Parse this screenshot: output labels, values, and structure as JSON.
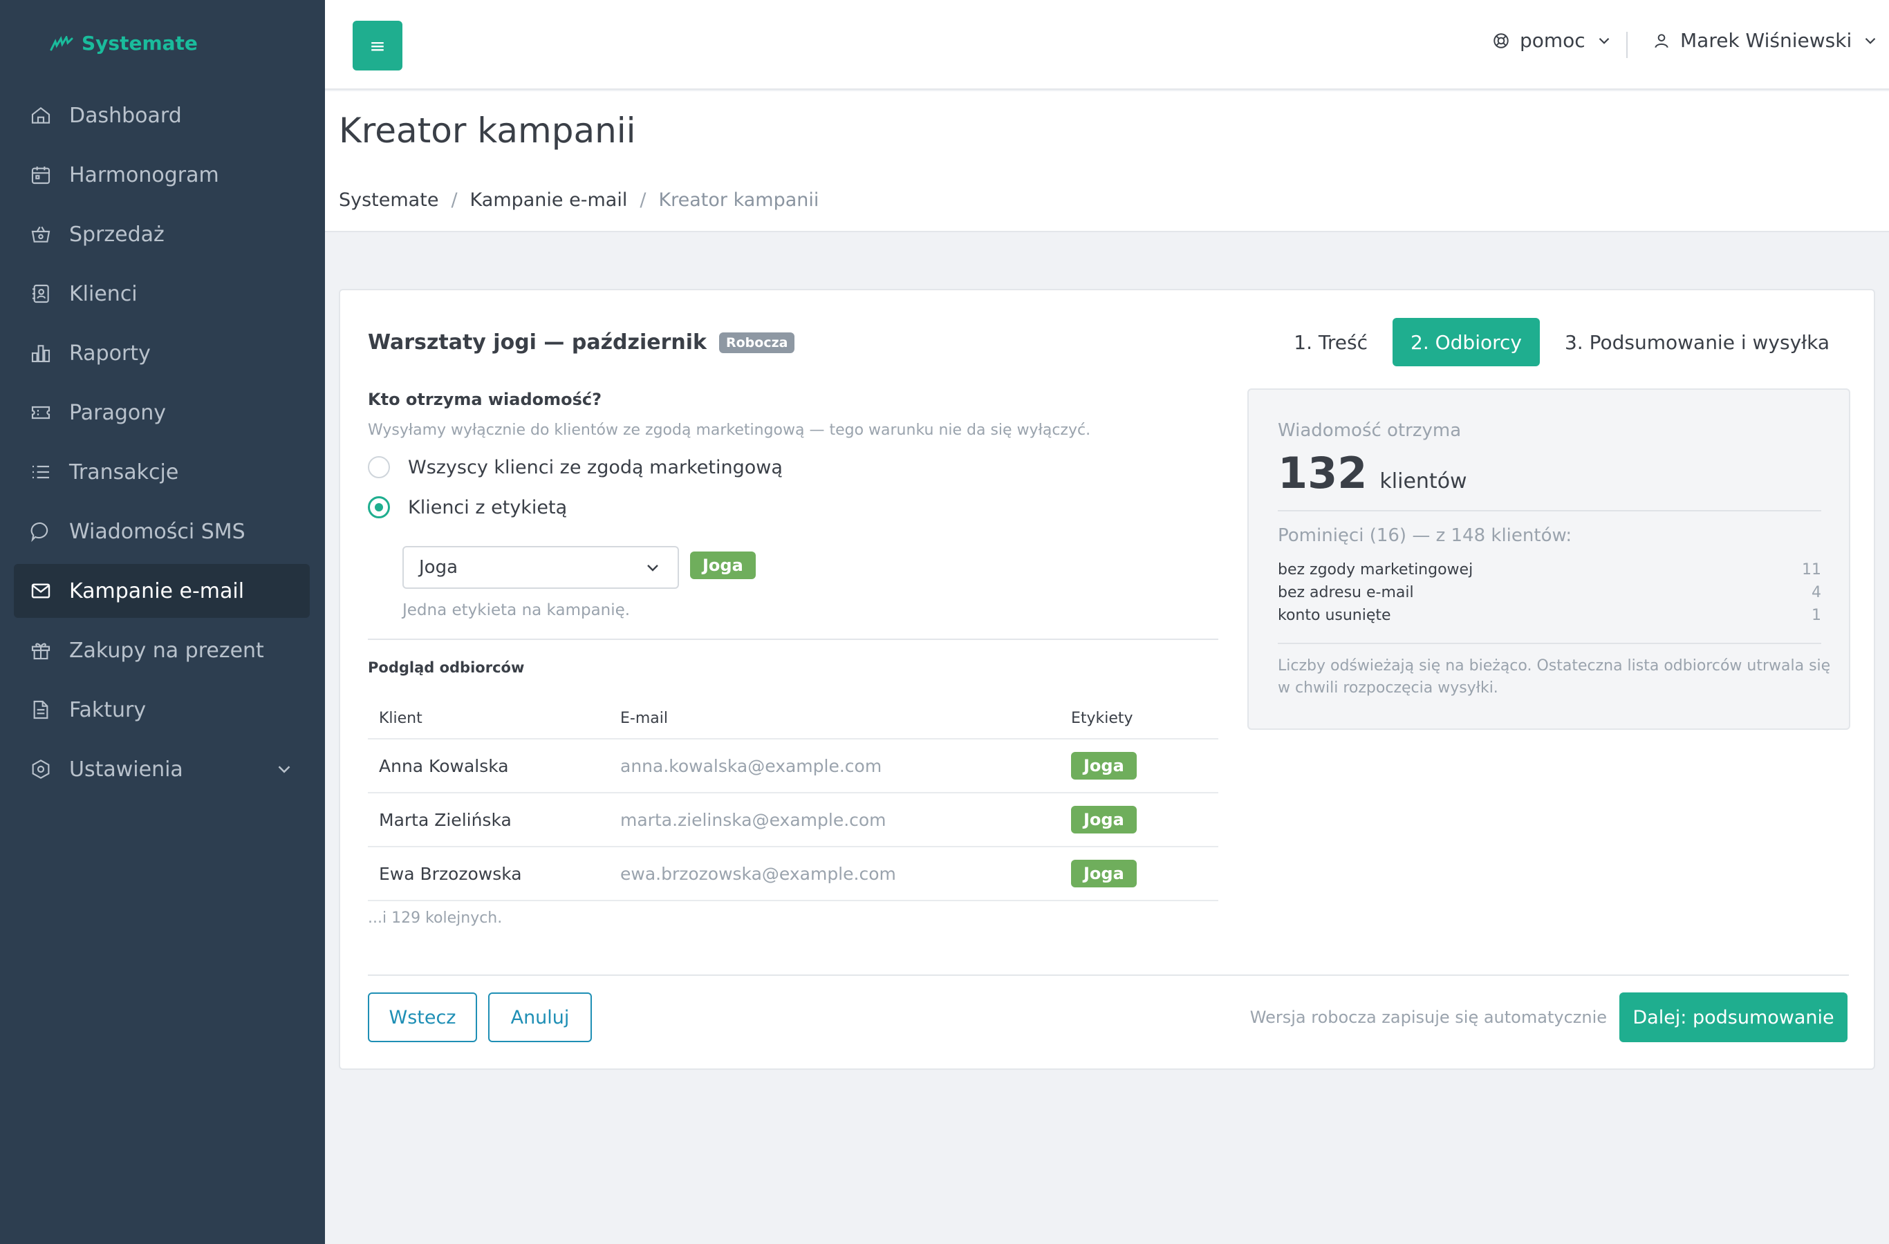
{
  "brand": {
    "name": "Systemate"
  },
  "sidebar": {
    "items": [
      {
        "label": "Dashboard",
        "icon": "home-icon"
      },
      {
        "label": "Harmonogram",
        "icon": "calendar-icon"
      },
      {
        "label": "Sprzedaż",
        "icon": "basket-icon"
      },
      {
        "label": "Klienci",
        "icon": "contacts-icon"
      },
      {
        "label": "Raporty",
        "icon": "bar-chart-icon"
      },
      {
        "label": "Paragony",
        "icon": "ticket-icon"
      },
      {
        "label": "Transakcje",
        "icon": "list-icon"
      },
      {
        "label": "Wiadomości SMS",
        "icon": "message-icon"
      },
      {
        "label": "Kampanie e-mail",
        "icon": "mail-icon",
        "active": true
      },
      {
        "label": "Zakupy na prezent",
        "icon": "gift-icon"
      },
      {
        "label": "Faktury",
        "icon": "document-icon"
      },
      {
        "label": "Ustawienia",
        "icon": "settings-icon",
        "has_submenu": true
      }
    ]
  },
  "topbar": {
    "menu_glyph": "≡",
    "help_label": "pomoc",
    "user_name": "Marek Wiśniewski"
  },
  "page": {
    "title": "Kreator kampanii",
    "breadcrumb": [
      "Systemate",
      "Kampanie e-mail",
      "Kreator kampanii"
    ],
    "breadcrumb_sep": "/"
  },
  "campaign": {
    "title": "Warsztaty jogi — październik",
    "status_badge": "Robocza"
  },
  "steps": [
    {
      "label": "1. Treść"
    },
    {
      "label": "2. Odbiorcy",
      "active": true
    },
    {
      "label": "3. Podsumowanie i wysyłka"
    }
  ],
  "audience": {
    "question": "Kto otrzyma wiadomość?",
    "hint": "Wysyłamy wyłącznie do klientów ze zgodą marketingową — tego warunku nie da się wyłączyć.",
    "option_all": "Wszyscy klienci ze zgodą marketingową",
    "option_tag": "Klienci z etykietą",
    "selected_option": "tag",
    "tag_select_value": "Joga",
    "tag_preview": "Joga",
    "tag_hint": "Jedna etykieta na kampanię."
  },
  "preview": {
    "title": "Podgląd odbiorców",
    "columns": [
      "Klient",
      "E-mail",
      "Etykiety"
    ],
    "rows": [
      {
        "client": "Anna Kowalska",
        "email": "anna.kowalska@example.com",
        "tag": "Joga"
      },
      {
        "client": "Marta Zielińska",
        "email": "marta.zielinska@example.com",
        "tag": "Joga"
      },
      {
        "client": "Ewa Brzozowska",
        "email": "ewa.brzozowska@example.com",
        "tag": "Joga"
      }
    ],
    "more": "...i 129 kolejnych."
  },
  "summary": {
    "label": "Wiadomość otrzyma",
    "count": "132",
    "unit": "klientów",
    "skipped_title": "Pominięci (16) — z 148 klientów:",
    "reasons": [
      {
        "label": "bez zgody marketingowej",
        "count": "11"
      },
      {
        "label": "bez adresu e-mail",
        "count": "4"
      },
      {
        "label": "konto usunięte",
        "count": "1"
      }
    ],
    "note": "Liczby odświeżają się na bieżąco. Ostateczna lista odbiorców utrwala się w chwili rozpoczęcia wysyłki."
  },
  "footer": {
    "back_label": "Wstecz",
    "cancel_label": "Anuluj",
    "autosave_text": "Wersja robocza zapisuje się automatycznie",
    "next_label": "Dalej: podsumowanie"
  },
  "colors": {
    "sidebar_bg": "#2d3e50",
    "accent": "#1fae8f",
    "tag": "#6fae5c",
    "outline": "#1f8fb5"
  }
}
